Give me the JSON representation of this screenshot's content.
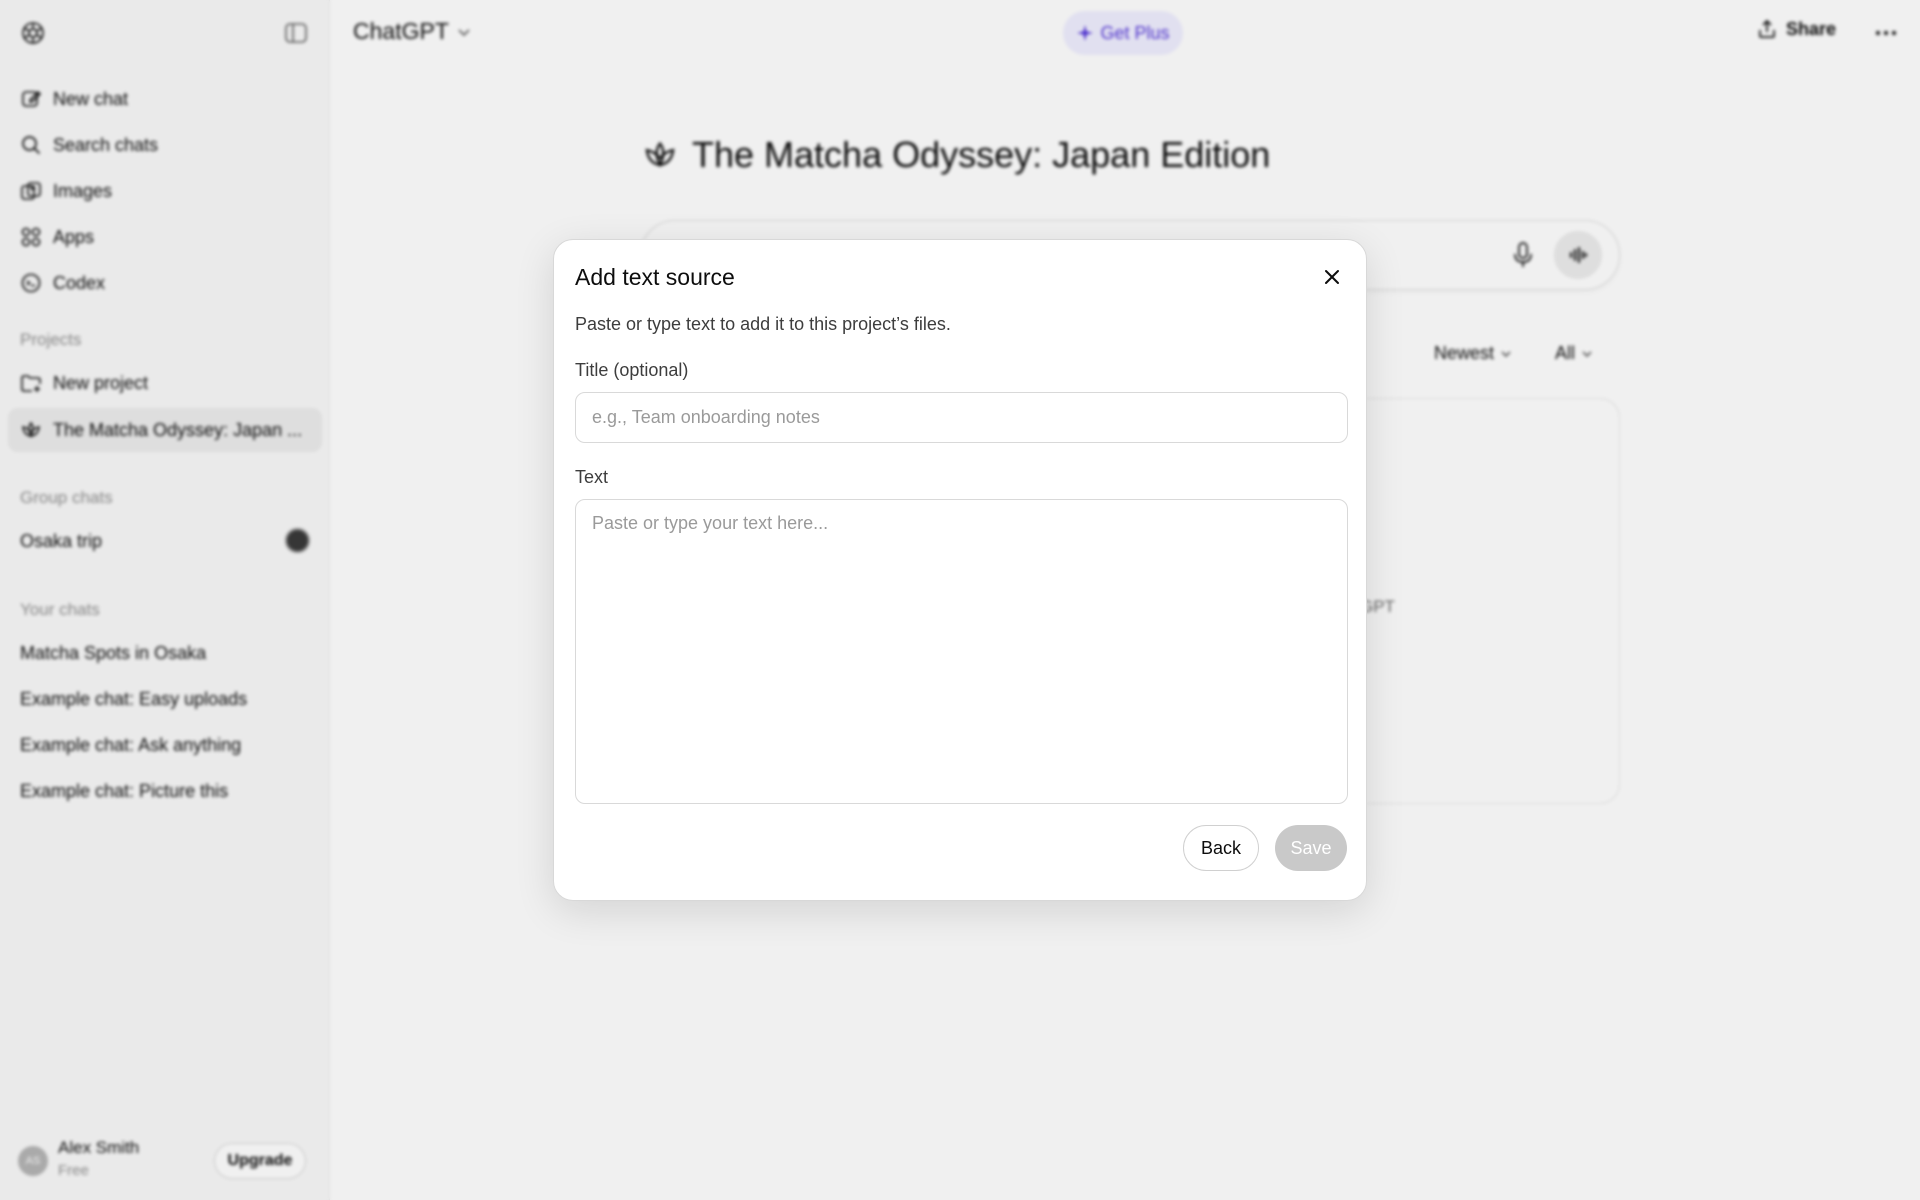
{
  "sidebar": {
    "nav": [
      {
        "label": "New chat",
        "icon": "edit-icon"
      },
      {
        "label": "Search chats",
        "icon": "search-icon"
      },
      {
        "label": "Images",
        "icon": "images-icon"
      },
      {
        "label": "Apps",
        "icon": "apps-icon"
      },
      {
        "label": "Codex",
        "icon": "codex-icon"
      }
    ],
    "projects_label": "Projects",
    "projects": [
      {
        "label": "New project",
        "icon": "folder-plus-icon"
      },
      {
        "label": "The Matcha Odyssey: Japan ...",
        "icon": "lotus-icon"
      }
    ],
    "group_chats_label": "Group chats",
    "group_chats": [
      {
        "label": "Osaka trip"
      }
    ],
    "your_chats_label": "Your chats",
    "chats": [
      {
        "label": "Matcha Spots in Osaka"
      },
      {
        "label": "Example chat: Easy uploads"
      },
      {
        "label": "Example chat: Ask anything"
      },
      {
        "label": "Example chat: Picture this"
      }
    ],
    "user": {
      "name": "Alex Smith",
      "plan": "Free",
      "initials": "AS",
      "upgrade_label": "Upgrade"
    }
  },
  "header": {
    "model": "ChatGPT",
    "get_plus": "Get Plus",
    "share": "Share"
  },
  "project": {
    "title": "The Matcha Odyssey: Japan Edition",
    "sort": "Newest",
    "filter": "All",
    "hint_fragment": "GPT"
  },
  "modal": {
    "title": "Add text source",
    "description": "Paste or type text to add it to this project’s files.",
    "title_label": "Title (optional)",
    "title_placeholder": "e.g., Team onboarding notes",
    "text_label": "Text",
    "text_placeholder": "Paste or type your text here...",
    "back_label": "Back",
    "save_label": "Save"
  },
  "colors": {
    "accent_plus": "#5436da",
    "save_disabled": "#c9c9c9",
    "sidebar_bg": "#f9f9f9"
  }
}
